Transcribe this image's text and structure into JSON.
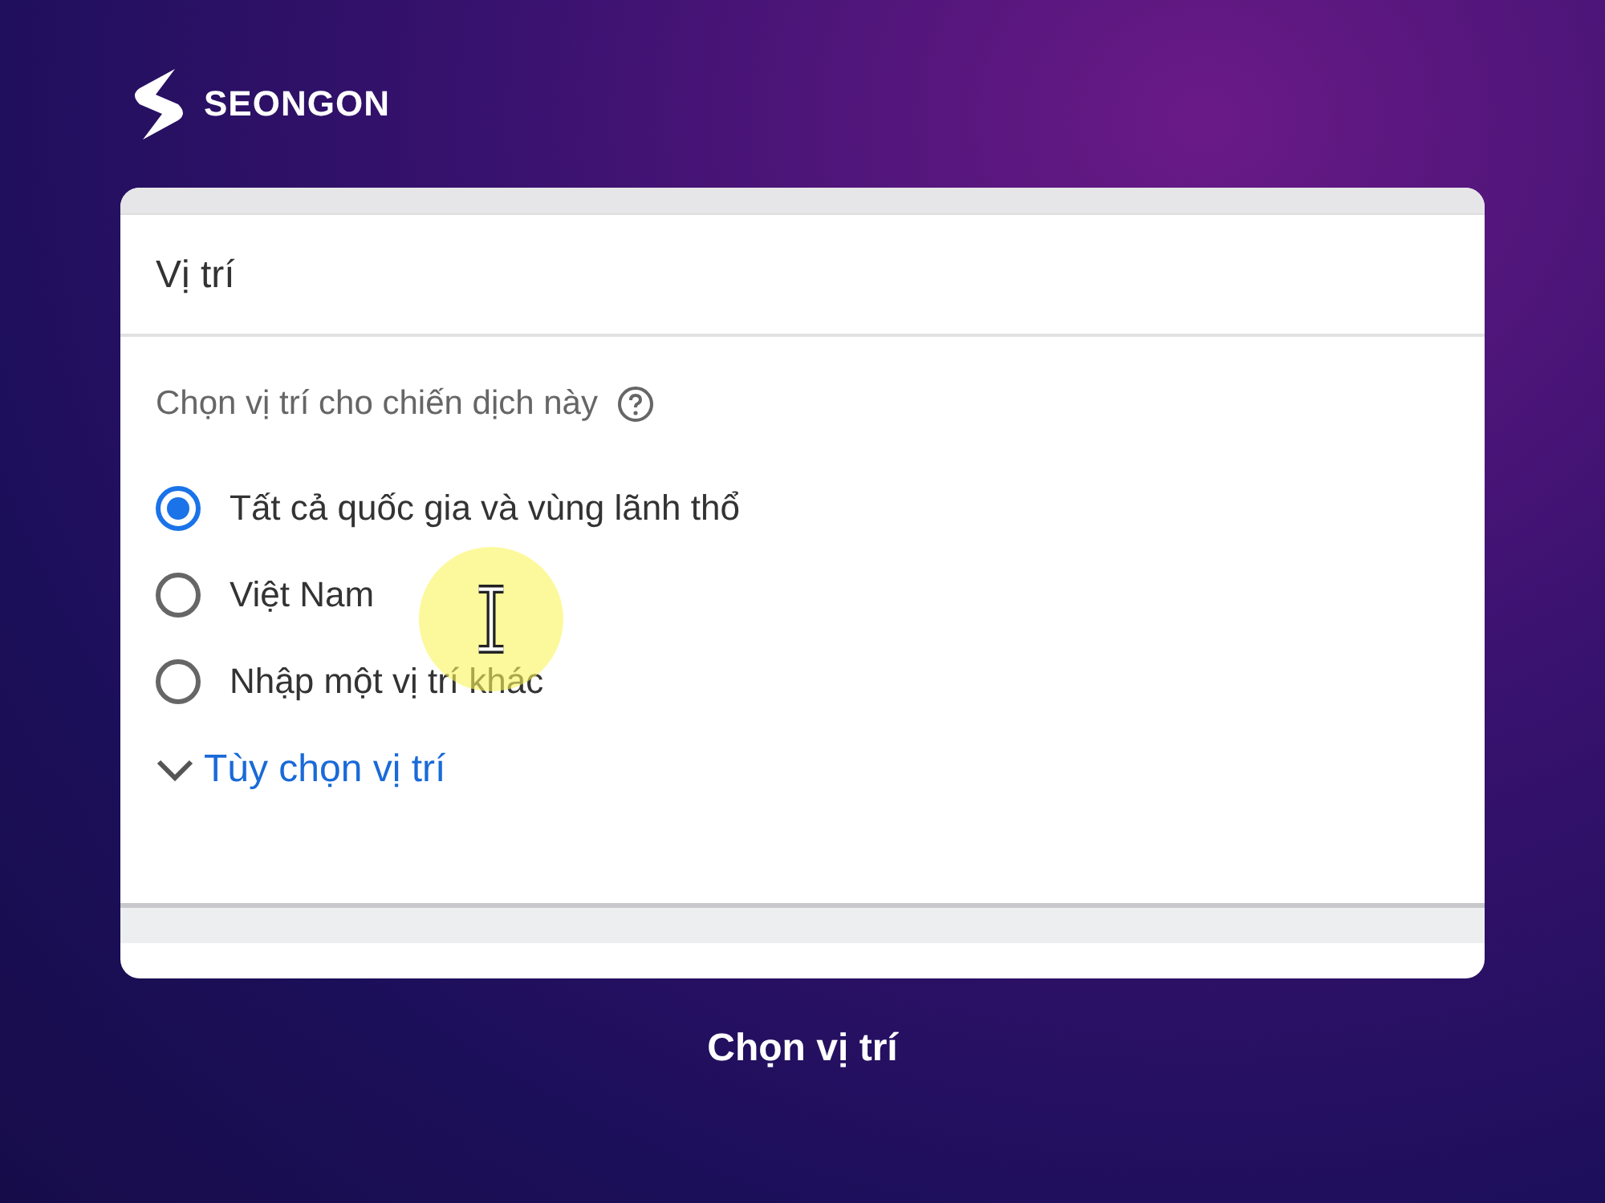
{
  "brand": {
    "name": "SEONGON"
  },
  "panel": {
    "title": "Vị trí",
    "prompt": "Chọn vị trí cho chiến dịch này",
    "options": [
      {
        "label": "Tất cả quốc gia và vùng lãnh thổ",
        "selected": true
      },
      {
        "label": "Việt Nam",
        "selected": false
      },
      {
        "label": "Nhập một vị trí khác",
        "selected": false
      }
    ],
    "link": "Tùy chọn vị trí"
  },
  "caption": "Chọn vị trí"
}
